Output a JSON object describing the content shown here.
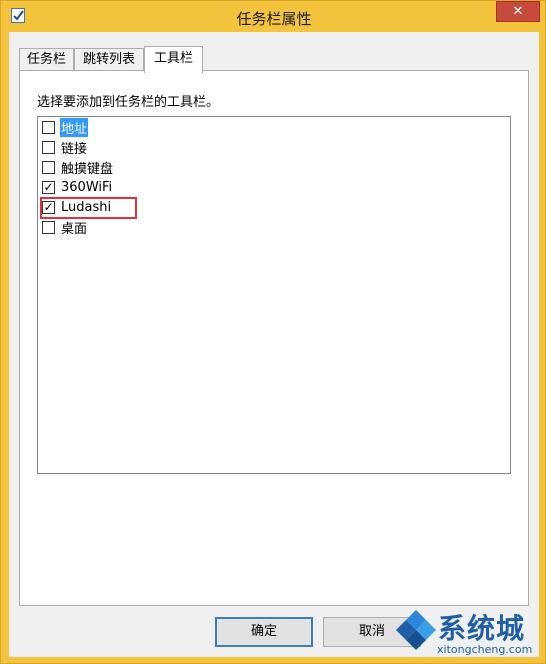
{
  "window": {
    "title": "任务栏属性",
    "close_label": "✕"
  },
  "tabs": [
    {
      "label": "任务栏",
      "active": false
    },
    {
      "label": "跳转列表",
      "active": false
    },
    {
      "label": "工具栏",
      "active": true
    }
  ],
  "toolbars_tab": {
    "instruction": "选择要添加到任务栏的工具栏。",
    "items": [
      {
        "label": "地址",
        "checked": false,
        "selected": true
      },
      {
        "label": "链接",
        "checked": false,
        "selected": false
      },
      {
        "label": "触摸键盘",
        "checked": false,
        "selected": false
      },
      {
        "label": "360WiFi",
        "checked": true,
        "selected": false
      },
      {
        "label": "Ludashi",
        "checked": true,
        "selected": false,
        "highlighted": true
      },
      {
        "label": "桌面",
        "checked": false,
        "selected": false
      }
    ]
  },
  "buttons": {
    "ok_label": "确定",
    "cancel_label": "取消"
  },
  "watermark": {
    "brand": "系统城",
    "url": "xitongcheng.com"
  },
  "colors": {
    "title_background": "#f3c33b",
    "close_button": "#c74b3d",
    "selection": "#3399ff",
    "highlight_box": "#e0303a",
    "watermark": "#1e5fa8"
  }
}
